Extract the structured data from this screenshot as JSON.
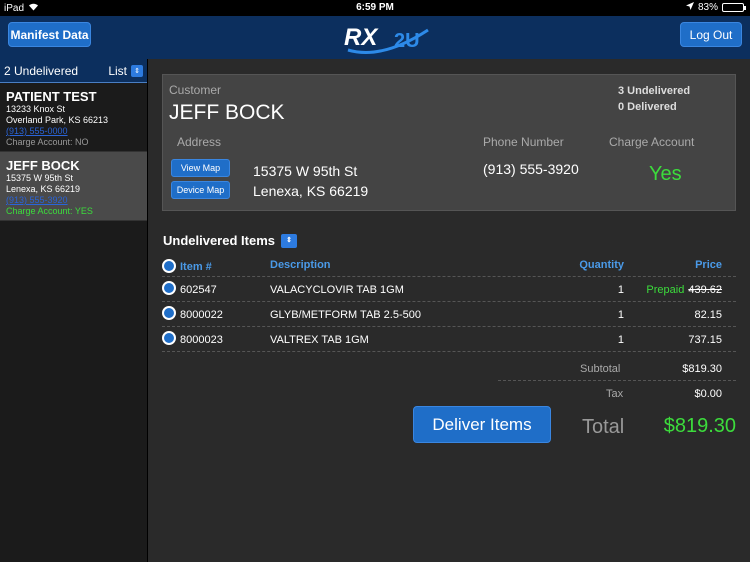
{
  "status_bar": {
    "carrier": "iPad",
    "time": "6:59 PM",
    "battery": "83%",
    "battery_level": 0.83
  },
  "navbar": {
    "manifest_label": "Manifest Data",
    "logout_label": "Log Out",
    "logo_text": "RX2U"
  },
  "sidebar": {
    "header": "2 Undelivered",
    "list_label": "List",
    "patients": [
      {
        "name": "PATIENT TEST",
        "address1": "13233 Knox St",
        "address2": "Overland Park, KS 66213",
        "phone": "(913) 555-0000",
        "charge": "Charge Account: NO"
      },
      {
        "name": "JEFF BOCK",
        "address1": "15375 W 95th St",
        "address2": "Lenexa, KS 66219",
        "phone": "(913) 555-3920",
        "charge": "Charge Account: YES"
      }
    ]
  },
  "customer": {
    "label": "Customer",
    "name": "JEFF BOCK",
    "undelivered": "3 Undelivered",
    "delivered": "0 Delivered",
    "address_label": "Address",
    "phone_label": "Phone Number",
    "charge_label": "Charge Account",
    "view_map": "View Map",
    "device_map": "Device Map",
    "address1": "15375 W 95th St",
    "address2": "Lenexa, KS 66219",
    "phone": "(913) 555-3920",
    "charge": "Yes"
  },
  "items": {
    "title": "Undelivered Items",
    "headers": {
      "item": "Item #",
      "description": "Description",
      "quantity": "Quantity",
      "price": "Price"
    },
    "rows": [
      {
        "item": "602547",
        "description": "VALACYCLOVIR TAB 1GM",
        "quantity": "1",
        "prepaid": "Prepaid",
        "price": "439.62"
      },
      {
        "item": "8000022",
        "description": "GLYB/METFORM TAB 2.5-500",
        "quantity": "1",
        "prepaid": "",
        "price": "82.15"
      },
      {
        "item": "8000023",
        "description": "VALTREX TAB 1GM",
        "quantity": "1",
        "prepaid": "",
        "price": "737.15"
      }
    ]
  },
  "summary": {
    "subtotal_label": "Subtotal",
    "subtotal": "$819.30",
    "tax_label": "Tax",
    "tax": "$0.00",
    "total_label": "Total",
    "total": "$819.30",
    "deliver_label": "Deliver Items"
  },
  "colors": {
    "nav": "#0c2f5e",
    "button": "#1f6ec8",
    "accent_green": "#3cdc3c",
    "header_blue": "#4a9ae8"
  }
}
